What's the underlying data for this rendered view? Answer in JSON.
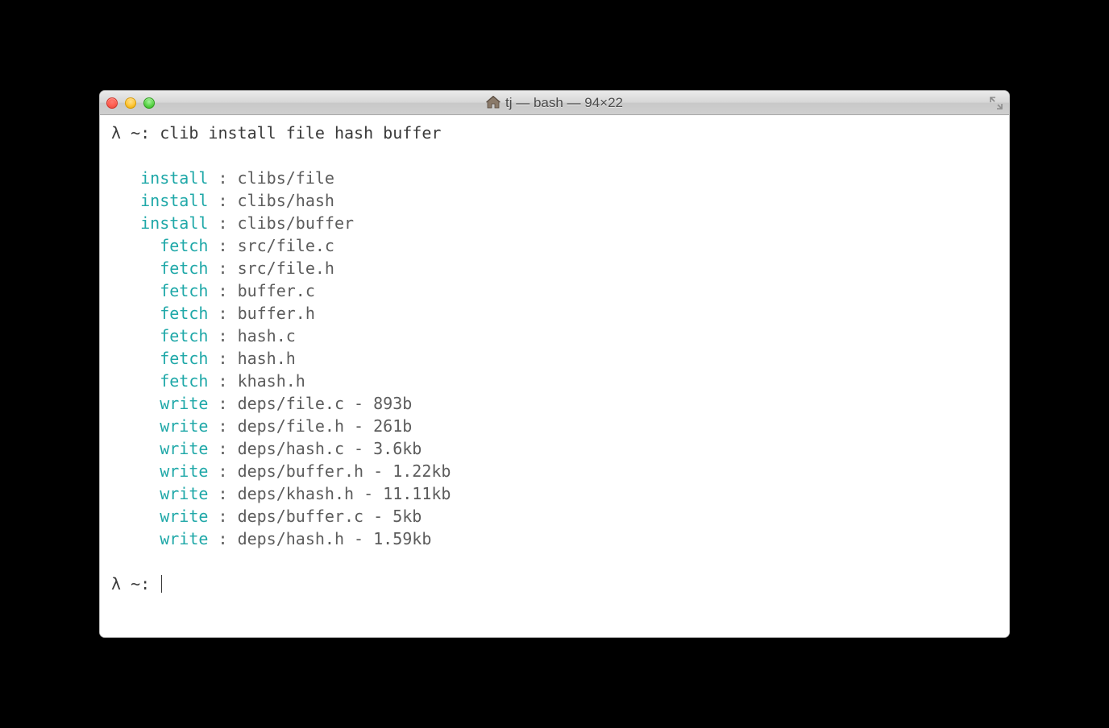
{
  "window": {
    "title": "tj — bash — 94×22"
  },
  "terminal": {
    "prompt1_symbol": "λ ~:",
    "prompt1_command": "clib install file hash buffer",
    "lines": [
      {
        "indent": "   ",
        "keyword": "install",
        "sep": " : ",
        "value": "clibs/file"
      },
      {
        "indent": "   ",
        "keyword": "install",
        "sep": " : ",
        "value": "clibs/hash"
      },
      {
        "indent": "   ",
        "keyword": "install",
        "sep": " : ",
        "value": "clibs/buffer"
      },
      {
        "indent": "     ",
        "keyword": "fetch",
        "sep": " : ",
        "value": "src/file.c"
      },
      {
        "indent": "     ",
        "keyword": "fetch",
        "sep": " : ",
        "value": "src/file.h"
      },
      {
        "indent": "     ",
        "keyword": "fetch",
        "sep": " : ",
        "value": "buffer.c"
      },
      {
        "indent": "     ",
        "keyword": "fetch",
        "sep": " : ",
        "value": "buffer.h"
      },
      {
        "indent": "     ",
        "keyword": "fetch",
        "sep": " : ",
        "value": "hash.c"
      },
      {
        "indent": "     ",
        "keyword": "fetch",
        "sep": " : ",
        "value": "hash.h"
      },
      {
        "indent": "     ",
        "keyword": "fetch",
        "sep": " : ",
        "value": "khash.h"
      },
      {
        "indent": "     ",
        "keyword": "write",
        "sep": " : ",
        "value": "deps/file.c - 893b"
      },
      {
        "indent": "     ",
        "keyword": "write",
        "sep": " : ",
        "value": "deps/file.h - 261b"
      },
      {
        "indent": "     ",
        "keyword": "write",
        "sep": " : ",
        "value": "deps/hash.c - 3.6kb"
      },
      {
        "indent": "     ",
        "keyword": "write",
        "sep": " : ",
        "value": "deps/buffer.h - 1.22kb"
      },
      {
        "indent": "     ",
        "keyword": "write",
        "sep": " : ",
        "value": "deps/khash.h - 11.11kb"
      },
      {
        "indent": "     ",
        "keyword": "write",
        "sep": " : ",
        "value": "deps/buffer.c - 5kb"
      },
      {
        "indent": "     ",
        "keyword": "write",
        "sep": " : ",
        "value": "deps/hash.h - 1.59kb"
      }
    ],
    "prompt2_symbol": "λ ~:",
    "prompt2_command": ""
  }
}
